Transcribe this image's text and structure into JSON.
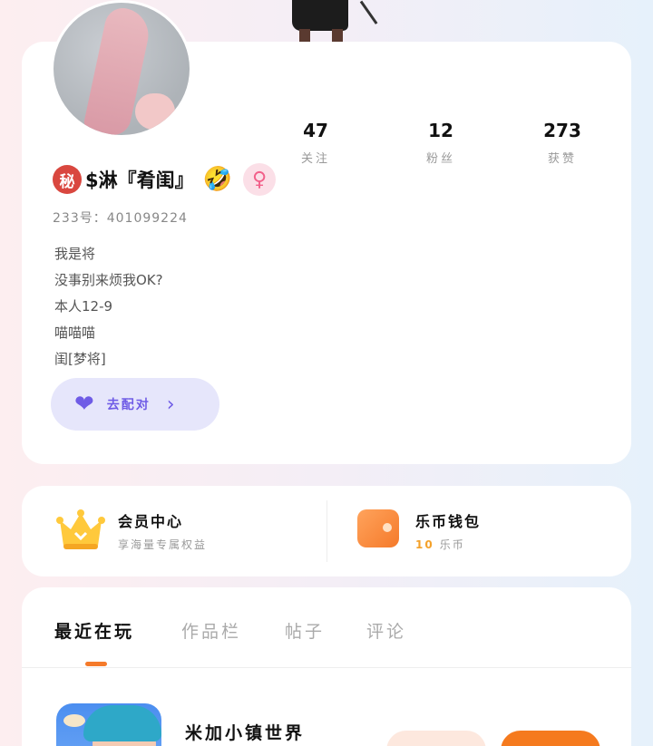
{
  "profile": {
    "stats": [
      {
        "value": "47",
        "label": "关注"
      },
      {
        "value": "12",
        "label": "粉丝"
      },
      {
        "value": "273",
        "label": "获赞"
      }
    ],
    "secret_badge": "秘",
    "username": "$淋『肴闺』",
    "emoji": "🤣",
    "gender_symbol": "♀",
    "uid": "233号：401099224",
    "bio_lines": [
      "我是将",
      "没事别来烦我OK?",
      "本人12-9",
      "喵喵喵",
      "闺[梦将]"
    ],
    "pair_button_label": "去配对",
    "pair_icon": "heart-icon"
  },
  "vip": {
    "member": {
      "title": "会员中心",
      "subtitle": "享海量专属权益",
      "icon": "crown-icon"
    },
    "wallet": {
      "title": "乐币钱包",
      "balance": "10",
      "unit": "乐币",
      "icon": "wallet-icon"
    }
  },
  "tabs": [
    {
      "label": "最近在玩",
      "active": true
    },
    {
      "label": "作品栏",
      "active": false
    },
    {
      "label": "帖子",
      "active": false
    },
    {
      "label": "评论",
      "active": false
    }
  ],
  "recent_game": {
    "title": "米加小镇世界"
  },
  "colors": {
    "accent": "#f57a2a",
    "pair": "#6f5ce6",
    "secret": "#d9473f",
    "gender": "#f2608a"
  }
}
